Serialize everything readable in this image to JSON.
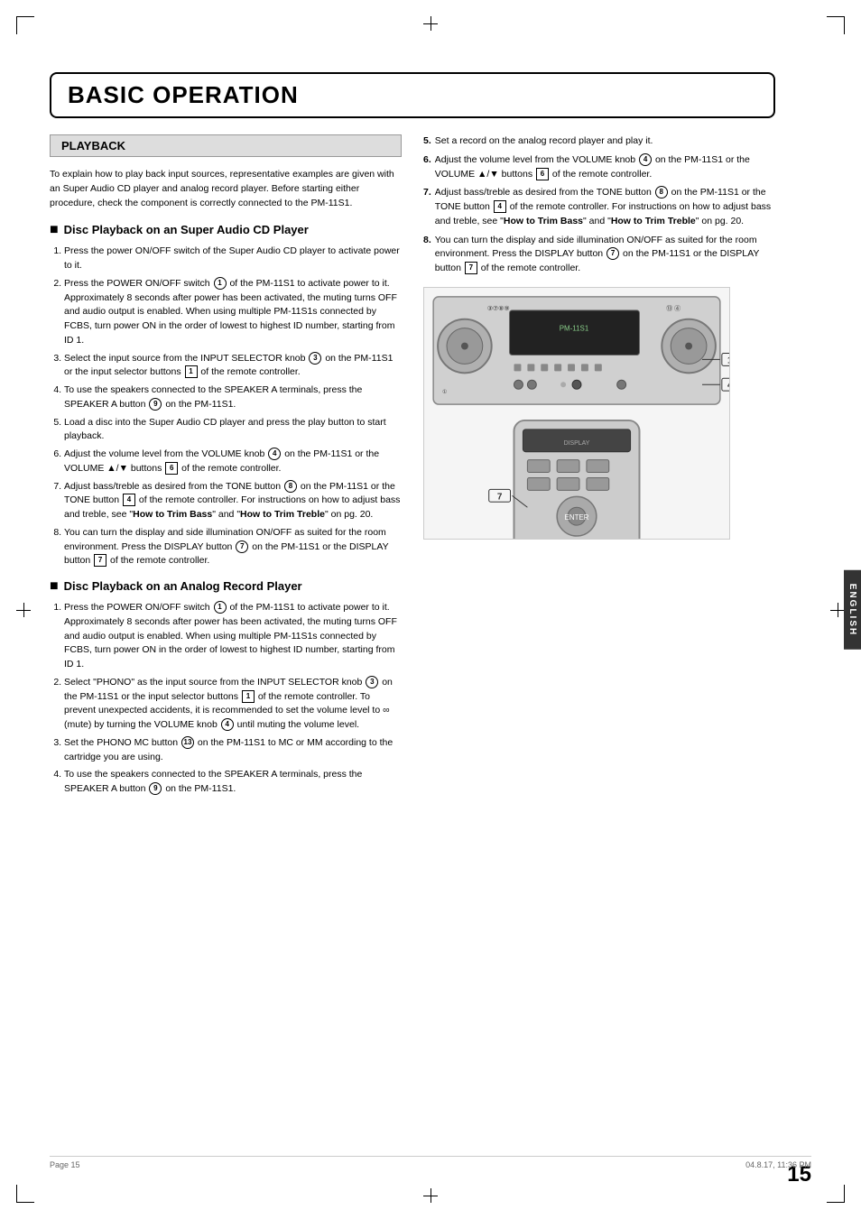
{
  "page": {
    "title": "BASIC OPERATION",
    "number": "15",
    "footer_left": "Page 15",
    "footer_right": "04.8.17, 11:36 PM",
    "side_label": "ENGLISH"
  },
  "playback": {
    "header": "PLAYBACK",
    "intro": "To explain how to play back input sources, representative examples are given with an Super Audio CD player and analog record player. Before starting either procedure, check the component is correctly connected to the PM-11S1.",
    "sacd_title": "Disc Playback on an Super Audio CD Player",
    "sacd_steps": [
      "Press the power ON/OFF switch of the Super Audio CD player to activate power to it.",
      "Press the POWER ON/OFF switch ① of the PM-11S1 to activate power to it. Approximately 8 seconds after power has been activated, the muting turns OFF and audio output is enabled. When using multiple PM-11S1s connected by FCBS, turn power ON in the order of lowest to highest ID number, starting from ID 1.",
      "Select the input source from the INPUT SELECTOR knob ③ on the PM-11S1 or the input selector buttons [1] of the remote controller.",
      "To use the speakers connected to the SPEAKER A terminals, press the SPEAKER A button ⑨ on the PM-11S1.",
      "Load a disc into the Super Audio CD player and press the play button to start playback.",
      "Adjust the volume level from the VOLUME knob ④ on the PM-11S1 or the VOLUME ▲/▼ buttons [6] of the remote controller.",
      "Adjust bass/treble as desired from the TONE button ⑧ on the PM-11S1 or the TONE button [4] of the remote controller. For instructions on how to adjust bass and treble, see \"How to Trim Bass\" and \"How to Trim Treble\" on pg. 20.",
      "You can turn the display and side illumination ON/OFF as suited for the room environment. Press the DISPLAY button ⑦ on the PM-11S1 or the DISPLAY button [7] of the remote controller."
    ],
    "analog_title": "Disc Playback on an Analog Record Player",
    "analog_steps": [
      "Press the POWER ON/OFF switch ① of the PM-11S1 to activate power to it. Approximately 8 seconds after power has been activated, the muting turns OFF and audio output is enabled. When using multiple PM-11S1s connected by FCBS, turn power ON in the order of lowest to highest ID number, starting from ID 1.",
      "Select \"PHONO\" as the input source from the INPUT SELECTOR knob ③ on the PM-11S1 or the input selector buttons [1] of the remote controller. To prevent unexpected accidents, it is recommended to set the volume level to ∞ (mute) by turning the VOLUME knob ④ until muting the volume level.",
      "Set the PHONO MC button ⑬ on the PM-11S1 to MC or MM according to the cartridge you are using.",
      "To use the speakers connected to the SPEAKER A terminals, press the SPEAKER A button ⑨ on the PM-11S1."
    ],
    "right_steps": [
      "Set a record on the analog record player and play it.",
      "Adjust the volume level from the VOLUME knob ④ on the PM-11S1 or the VOLUME ▲/▼ buttons [6] of the remote controller.",
      "Adjust bass/treble as desired from the TONE button ⑧ on the PM-11S1 or the TONE button [4] of the remote controller. For instructions on how to adjust bass and treble, see \"How to Trim Bass\" and \"How to Trim Treble\" on pg. 20.",
      "You can turn the display and side illumination ON/OFF as suited for the room environment. Press the DISPLAY button ⑦ on the PM-11S1 or the DISPLAY button [7] of the remote controller."
    ]
  }
}
